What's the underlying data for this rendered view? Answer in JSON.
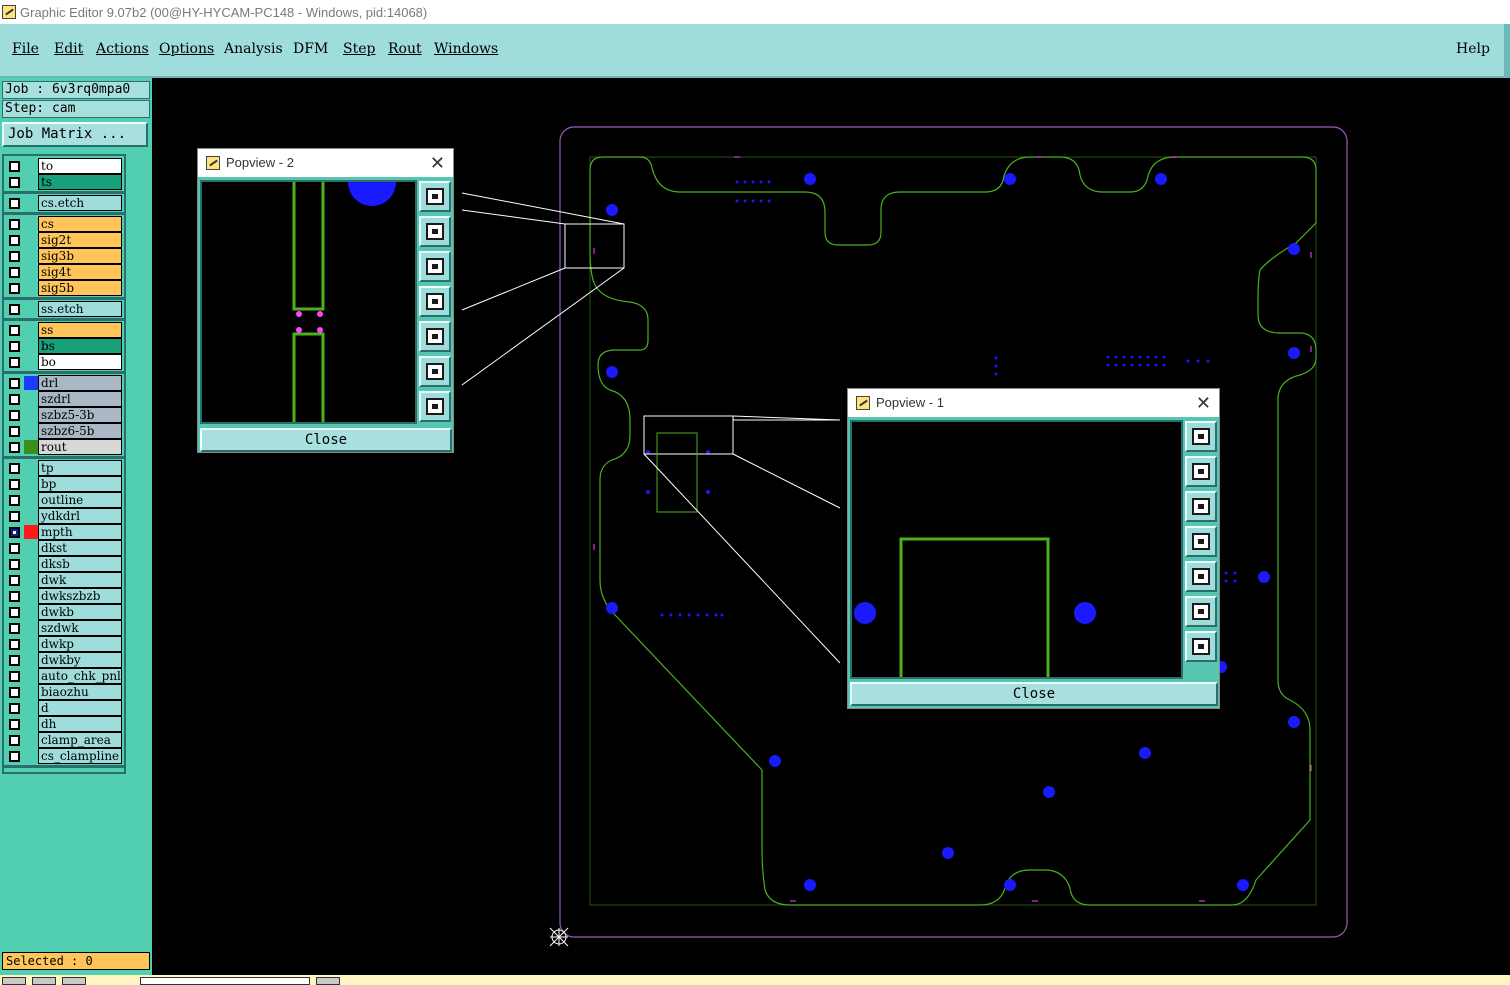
{
  "window": {
    "title": "Graphic Editor 9.07b2 (00@HY-HYCAM-PC148 - Windows, pid:14068)"
  },
  "menu": {
    "items": [
      {
        "label": "File"
      },
      {
        "label": "Edit"
      },
      {
        "label": "Actions"
      },
      {
        "label": "Options"
      },
      {
        "label": "Analysis"
      },
      {
        "label": "DFM"
      },
      {
        "label": "Step"
      },
      {
        "label": "Rout"
      },
      {
        "label": "Windows"
      }
    ],
    "help": "Help"
  },
  "info": {
    "job": "Job : 6v3rq0mpa0",
    "step": "Step: cam",
    "job_matrix": "Job Matrix ..."
  },
  "layers": [
    {
      "name": "to",
      "bg": "#ffffff",
      "swatch": "",
      "checked": false
    },
    {
      "name": "ts",
      "bg": "#1aa079",
      "swatch": "",
      "checked": false
    },
    {
      "name": "cs.etch",
      "bg": "#9fdcdc",
      "swatch": "",
      "checked": false
    },
    {
      "name": "cs",
      "bg": "#ffc55a",
      "swatch": "",
      "checked": false
    },
    {
      "name": "sig2t",
      "bg": "#ffc55a",
      "swatch": "",
      "checked": false
    },
    {
      "name": "sig3b",
      "bg": "#ffc55a",
      "swatch": "",
      "checked": false
    },
    {
      "name": "sig4t",
      "bg": "#ffc55a",
      "swatch": "",
      "checked": false
    },
    {
      "name": "sig5b",
      "bg": "#ffc55a",
      "swatch": "",
      "checked": false
    },
    {
      "name": "ss.etch",
      "bg": "#9fdcdc",
      "swatch": "",
      "checked": false
    },
    {
      "name": "ss",
      "bg": "#ffc55a",
      "swatch": "",
      "checked": false
    },
    {
      "name": "bs",
      "bg": "#1aa079",
      "swatch": "",
      "checked": false
    },
    {
      "name": "bo",
      "bg": "#ffffff",
      "swatch": "",
      "checked": false
    },
    {
      "name": "drl",
      "bg": "#a9b8c4",
      "swatch": "#1a3cff",
      "checked": false
    },
    {
      "name": "szdrl",
      "bg": "#a9b8c4",
      "swatch": "",
      "checked": false
    },
    {
      "name": "szbz5-3b",
      "bg": "#a9b8c4",
      "swatch": "",
      "checked": false
    },
    {
      "name": "szbz6-5b",
      "bg": "#a9b8c4",
      "swatch": "",
      "checked": false
    },
    {
      "name": "rout",
      "bg": "#d8d8d8",
      "swatch": "#3a8f1a",
      "checked": false
    },
    {
      "name": "tp",
      "bg": "#9fdcdc",
      "swatch": "",
      "checked": false
    },
    {
      "name": "bp",
      "bg": "#9fdcdc",
      "swatch": "",
      "checked": false
    },
    {
      "name": "outline",
      "bg": "#9fdcdc",
      "swatch": "",
      "checked": false
    },
    {
      "name": "ydkdrl",
      "bg": "#9fdcdc",
      "swatch": "",
      "checked": false
    },
    {
      "name": "mpth",
      "bg": "#9fdcdc",
      "swatch": "#ff1a1a",
      "checked": true
    },
    {
      "name": "dkst",
      "bg": "#9fdcdc",
      "swatch": "",
      "checked": false
    },
    {
      "name": "dksb",
      "bg": "#9fdcdc",
      "swatch": "",
      "checked": false
    },
    {
      "name": "dwk",
      "bg": "#9fdcdc",
      "swatch": "",
      "checked": false
    },
    {
      "name": "dwkszbzb",
      "bg": "#9fdcdc",
      "swatch": "",
      "checked": false
    },
    {
      "name": "dwkb",
      "bg": "#9fdcdc",
      "swatch": "",
      "checked": false
    },
    {
      "name": "szdwk",
      "bg": "#9fdcdc",
      "swatch": "",
      "checked": false
    },
    {
      "name": "dwkp",
      "bg": "#9fdcdc",
      "swatch": "",
      "checked": false
    },
    {
      "name": "dwkby",
      "bg": "#9fdcdc",
      "swatch": "",
      "checked": false
    },
    {
      "name": "auto_chk_pnl",
      "bg": "#9fdcdc",
      "swatch": "",
      "checked": false
    },
    {
      "name": "biaozhu",
      "bg": "#9fdcdc",
      "swatch": "",
      "checked": false
    },
    {
      "name": "d",
      "bg": "#9fdcdc",
      "swatch": "",
      "checked": false
    },
    {
      "name": "dh",
      "bg": "#9fdcdc",
      "swatch": "",
      "checked": false
    },
    {
      "name": "clamp_area",
      "bg": "#9fdcdc",
      "swatch": "",
      "checked": false
    },
    {
      "name": "cs_clampline",
      "bg": "#9fdcdc",
      "swatch": "",
      "checked": false
    }
  ],
  "selected": "Selected : 0",
  "popview2": {
    "title": "Popview - 2",
    "close": "Close"
  },
  "popview1": {
    "title": "Popview - 1",
    "close": "Close"
  },
  "colors": {
    "rout": "#4caf1e",
    "drill": "#1a1aff",
    "profile": "#9b59b6",
    "bg": "#000000"
  }
}
